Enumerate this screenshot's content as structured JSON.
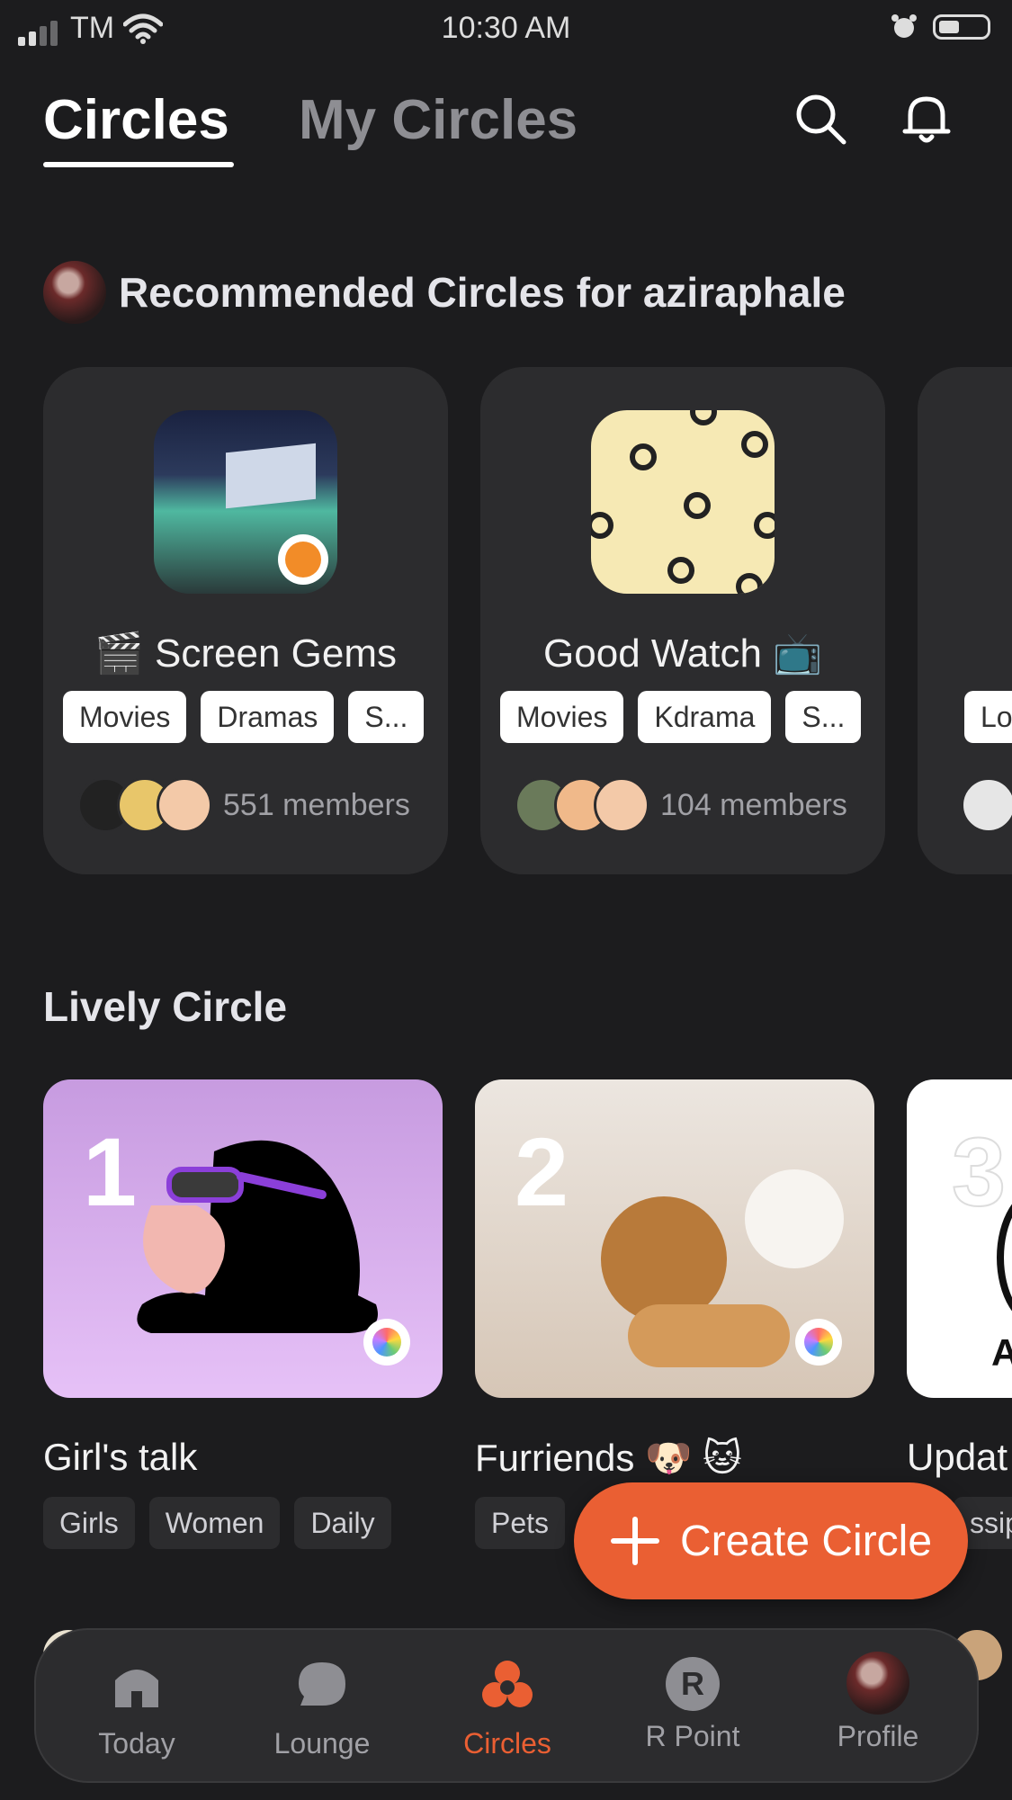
{
  "status_bar": {
    "carrier": "TM",
    "time": "10:30 AM"
  },
  "header": {
    "tabs": [
      {
        "label": "Circles",
        "active": true
      },
      {
        "label": "My Circles",
        "active": false
      }
    ],
    "search_icon": "search-icon",
    "bell_icon": "bell-icon"
  },
  "recommended": {
    "title": "Recommended Circles for aziraphale",
    "cards": [
      {
        "title": "🎬 Screen Gems",
        "tags": [
          "Movies",
          "Dramas",
          "S..."
        ],
        "members": "551 members"
      },
      {
        "title": "Good Watch 📺",
        "tags": [
          "Movies",
          "Kdrama",
          "S..."
        ],
        "members": "104 members"
      },
      {
        "title": "",
        "tags": [
          "Lo"
        ],
        "members": ""
      }
    ]
  },
  "lively": {
    "title": "Lively Circle",
    "cards": [
      {
        "rank": "1",
        "name": "Girl's talk",
        "tags": [
          "Girls",
          "Women",
          "Daily"
        ]
      },
      {
        "rank": "2",
        "name": "Furriends 🐶 🐱",
        "tags": [
          "Pets"
        ]
      },
      {
        "rank": "3",
        "name": "Updat",
        "tags": [
          "ssip"
        ],
        "cover_text": "A"
      }
    ]
  },
  "fab": {
    "label": "Create Circle"
  },
  "nav": {
    "items": [
      {
        "label": "Today",
        "active": false
      },
      {
        "label": "Lounge",
        "active": false
      },
      {
        "label": "Circles",
        "active": true
      },
      {
        "label": "R Point",
        "active": false
      },
      {
        "label": "Profile",
        "active": false
      }
    ],
    "r_point_glyph": "R"
  },
  "colors": {
    "accent": "#ea5f33",
    "background": "#1c1c1e",
    "card": "#2c2c2e"
  }
}
